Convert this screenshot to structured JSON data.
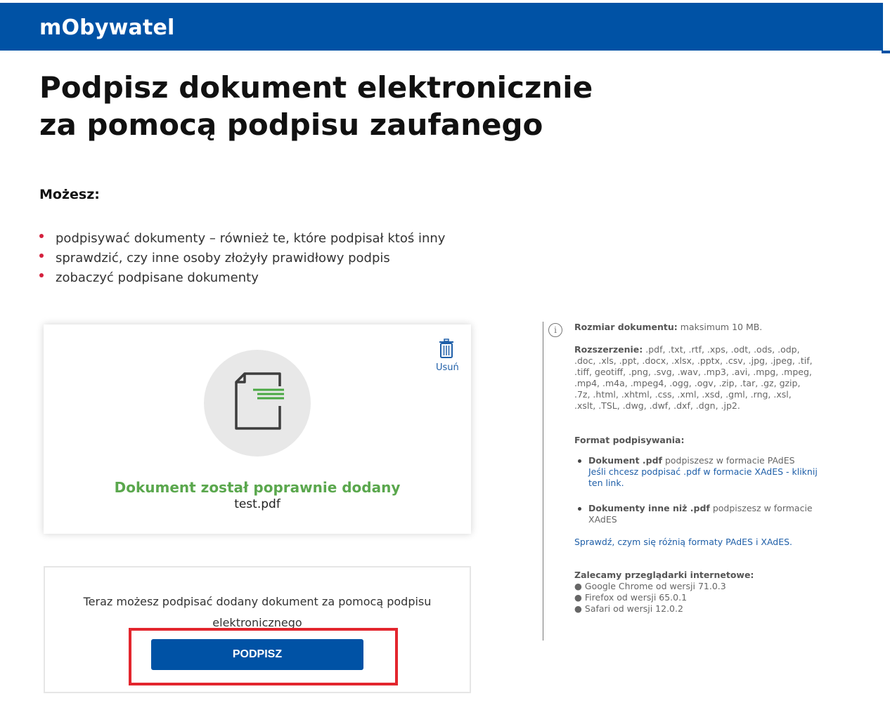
{
  "header": {
    "logo": "mObywatel"
  },
  "title": {
    "line1": "Podpisz dokument elektronicznie",
    "line2": "za pomocą podpisu zaufanego"
  },
  "intro": {
    "heading": "Możesz:",
    "items": [
      "podpisywać dokumenty – również te, które podpisał ktoś inny",
      "sprawdzić, czy inne osoby złożyły prawidłowy podpis",
      "zobaczyć podpisane dokumenty"
    ]
  },
  "upload": {
    "remove_label": "Usuń",
    "success_message": "Dokument został poprawnie dodany",
    "filename": "test.pdf"
  },
  "sign": {
    "text": "Teraz możesz podpisać dodany dokument za pomocą podpisu elektronicznego",
    "button_label": "PODPISZ"
  },
  "info": {
    "size_label": "Rozmiar dokumentu:",
    "size_value": " maksimum 10 MB.",
    "ext_label": "Rozszerzenie:",
    "ext_value": " .pdf, .txt, .rtf, .xps, .odt, .ods, .odp, .doc, .xls, .ppt, .docx, .xlsx, .pptx, .csv, .jpg, .jpeg, .tif, .tiff, geotiff, .png, .svg, .wav, .mp3, .avi, .mpg, .mpeg, .mp4, .m4a, .mpeg4, .ogg, .ogv, .zip, .tar, .gz, gzip, .7z, .html, .xhtml, .css, .xml, .xsd, .gml, .rng, .xsl, .xslt, .TSL, .dwg, .dwf, .dxf, .dgn, .jp2.",
    "format_heading": "Format podpisywania:",
    "pdf_label": "Dokument .pdf",
    "pdf_text": " podpiszesz w formacie PAdES",
    "pdf_link": "Jeśli chcesz podpisać .pdf w formacie XAdES - kliknij ten link.",
    "other_label": "Dokumenty inne niż .pdf",
    "other_text": " podpiszesz w formacie XAdES",
    "diff_link": "Sprawdź, czym się różnią formaty PAdES i XAdES.",
    "browsers_heading": "Zalecamy przeglądarki internetowe:",
    "browsers": [
      "● Google Chrome od wersji 71.0.3",
      "● Firefox od wersji 65.0.1",
      "● Safari od wersji 12.0.2"
    ]
  },
  "colors": {
    "brand_blue": "#0052a5",
    "success_green": "#5aa74d",
    "bullet_red": "#d4213d",
    "highlight_red": "#e3262e"
  }
}
